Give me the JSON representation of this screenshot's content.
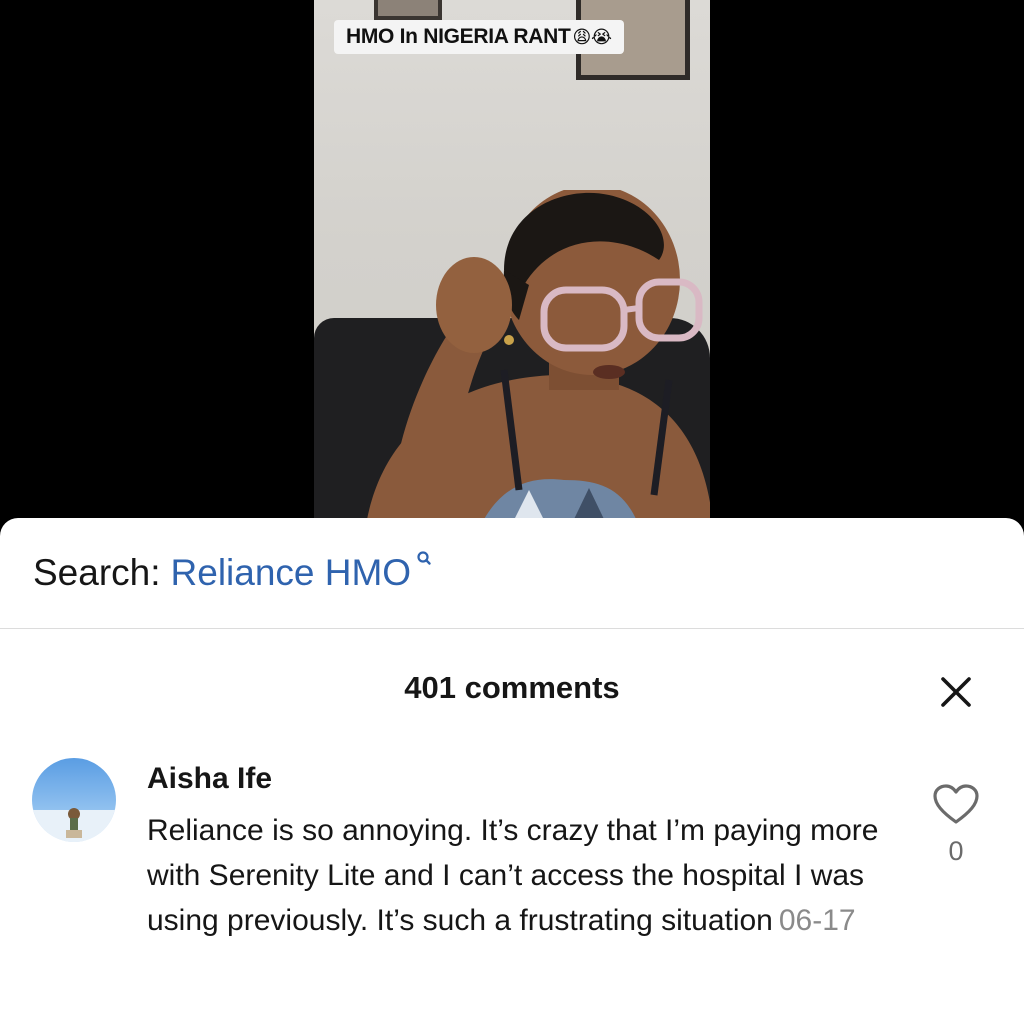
{
  "video": {
    "caption": "HMO In NIGERIA RANT",
    "caption_emojis": "😩😭"
  },
  "search": {
    "prefix": "Search:",
    "term": "Reliance HMO",
    "accent_color": "#2f63ae"
  },
  "comments": {
    "title": "401 comments",
    "close_icon": "close-icon",
    "items": [
      {
        "author": "Aisha Ife",
        "text": "Reliance is so annoying. It’s crazy that I’m paying more with Serenity Lite and I can’t access the hospital I was using previously. It’s such a frustrating situation",
        "date": "06-17",
        "likes": "0"
      }
    ]
  }
}
